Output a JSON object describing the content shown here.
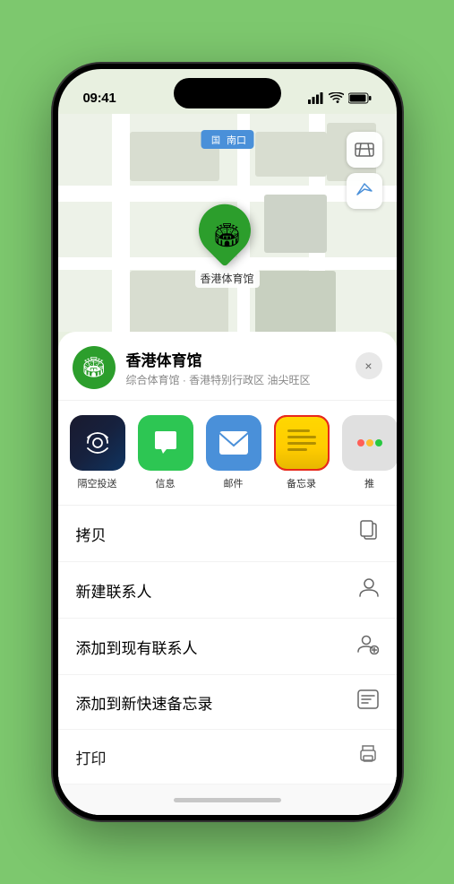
{
  "status_bar": {
    "time": "09:41",
    "signal_icon": "signal",
    "wifi_icon": "wifi",
    "battery_icon": "battery"
  },
  "map": {
    "north_label": "南口",
    "north_badge": "国",
    "controls": {
      "map_icon": "🗺",
      "location_icon": "⬆"
    },
    "pin": {
      "label": "香港体育馆",
      "icon": "🏟"
    }
  },
  "venue": {
    "name": "香港体育馆",
    "subtitle": "综合体育馆 · 香港特别行政区 油尖旺区",
    "icon": "🏟"
  },
  "share_items": [
    {
      "id": "airdrop",
      "label": "隔空投送",
      "style": "airdrop"
    },
    {
      "id": "messages",
      "label": "信息",
      "style": "messages"
    },
    {
      "id": "mail",
      "label": "邮件",
      "style": "mail"
    },
    {
      "id": "notes",
      "label": "备忘录",
      "style": "notes"
    },
    {
      "id": "more",
      "label": "推",
      "style": "more"
    }
  ],
  "actions": [
    {
      "id": "copy",
      "label": "拷贝",
      "icon": "copy"
    },
    {
      "id": "new-contact",
      "label": "新建联系人",
      "icon": "person"
    },
    {
      "id": "add-existing",
      "label": "添加到现有联系人",
      "icon": "person-add"
    },
    {
      "id": "quick-note",
      "label": "添加到新快速备忘录",
      "icon": "note"
    },
    {
      "id": "print",
      "label": "打印",
      "icon": "print"
    }
  ],
  "close_button_label": "×"
}
